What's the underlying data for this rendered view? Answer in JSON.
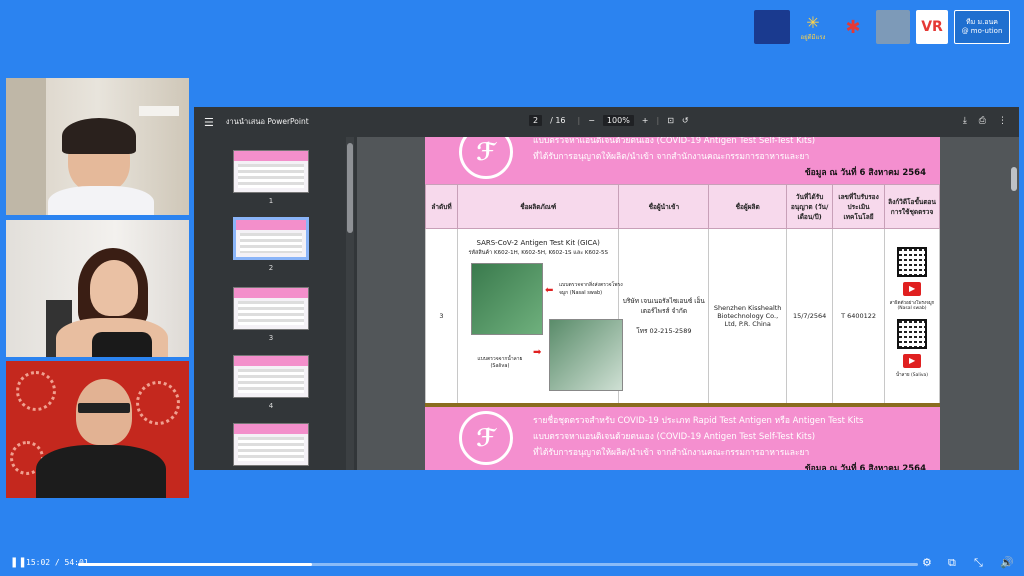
{
  "logos": [
    {
      "name": "org-logo-1",
      "text": ""
    },
    {
      "name": "org-logo-2",
      "text": "อยู่ดีมีแรง"
    },
    {
      "name": "org-logo-3",
      "text": "✱"
    },
    {
      "name": "org-logo-4",
      "text": ""
    },
    {
      "name": "vr-logo",
      "text": "VR"
    },
    {
      "name": "motion-logo",
      "text": "ทีม ม.อนค",
      "text2": "@ mo-ution"
    }
  ],
  "pdf_viewer": {
    "title": "งานนำเสนอ PowerPoint",
    "page_current": "2",
    "page_total": "/ 16",
    "zoom": "100%",
    "minus": "−",
    "plus": "+"
  },
  "thumbnails": [
    {
      "num": "1"
    },
    {
      "num": "2"
    },
    {
      "num": "3"
    },
    {
      "num": "4"
    },
    {
      "num": ""
    }
  ],
  "slide": {
    "line1": "แบบตรวจหาแอนติเจนด้วยตนเอง (COVID-19 Antigen Test Self-Test Kits)",
    "line2": "ที่ได้รับการอนุญาตให้ผลิต/นำเข้า จากสำนักงานคณะกรรมการอาหารและยา",
    "date": "ข้อมูล ณ วันที่ 6 สิงหาคม 2564",
    "table_headers": [
      "ลำดับที่",
      "ชื่อผลิตภัณฑ์",
      "ชื่อผู้นำเข้า",
      "ชื่อผู้ผลิต",
      "วันที่ได้รับอนุญาต (วัน/เดือน/ปี)",
      "เลขที่ใบรับรองประเมินเทคโนโลยี",
      "ลิงก์วิดีโอขั้นตอนการใช้ชุดตรวจ"
    ],
    "row": {
      "no": "3",
      "product_title": "SARS-CoV-2 Antigen Test Kit (GICA)",
      "product_code": "รหัสสินค้า K602-1H, K602-5H, K602-1S และ K602-5S",
      "nasal_label": "แบบตรวจจากสิ่งส่งตรวจโพรงจมูก (Nasal swab)",
      "saliva_label": "แบบตรวจจากน้ำลาย (Saliva)",
      "importer": "บริษัท เจนเนอรัลไซเอนซ์ เอ็นเตอร์ไพรส์ จำกัด",
      "importer_tel": "โทร 02-215-2589",
      "manufacturer": "Shenzhen Kisshealth Biotechnology Co., Ltd, P.R. China",
      "date": "15/7/2564",
      "cert": "T 6400122",
      "video_nasal": "สาธิตตัวอย่างโพรงจมูก (Nasal swab)",
      "video_saliva": "น้ำลาย (Saliva)"
    },
    "banner2_line0": "รายชื่อชุดตรวจสำหรับ COVID-19 ประเภท Rapid Test Antigen หรือ Antigen Test Kits",
    "banner2_line1": "แบบตรวจหาแอนติเจนด้วยตนเอง (COVID-19 Antigen Test Self-Test Kits)",
    "banner2_line2": "ที่ได้รับการอนุญาตให้ผลิต/นำเข้า จากสำนักงานคณะกรรมการอาหารและยา",
    "banner2_date": "ข้อมูล ณ วันที่ 6 สิงหาคม 2564"
  },
  "player": {
    "time": "15:02 / 54:01",
    "progress": 0.278
  }
}
